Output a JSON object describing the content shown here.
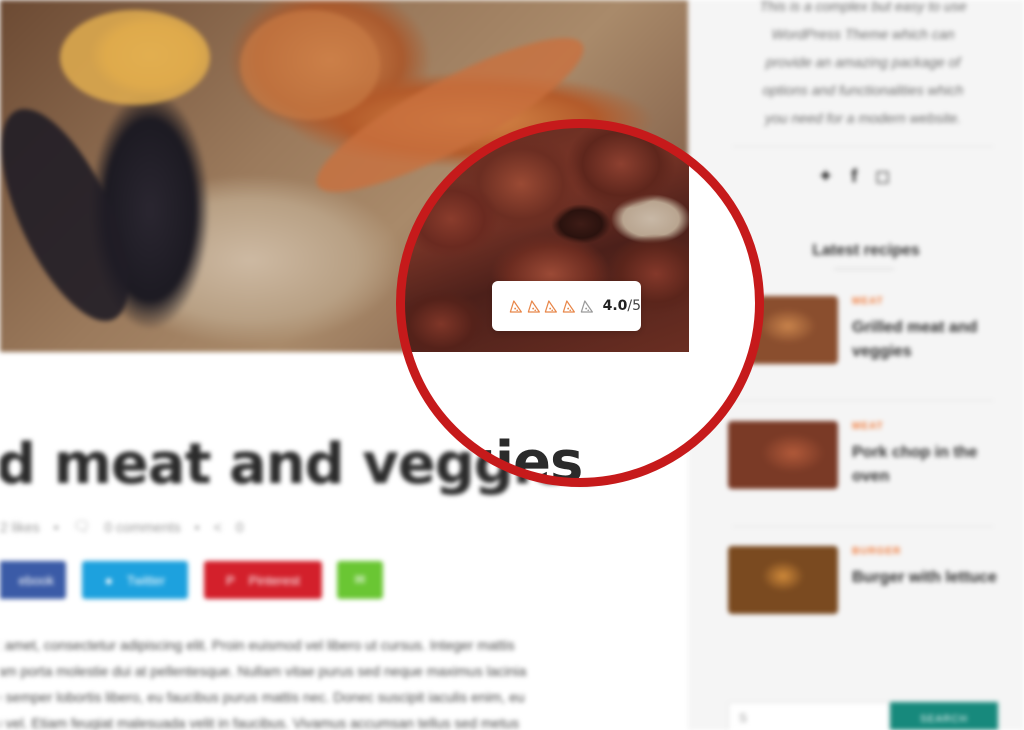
{
  "post": {
    "title": "d meat and veggies",
    "meta": {
      "likes": "2 likes",
      "comments": "0 comments",
      "shares": "0"
    },
    "share_buttons": {
      "facebook": "ebook",
      "twitter": "Twitter",
      "pinterest": "Pinterest"
    },
    "body_lines": [
      "it amet, consectetur adipiscing elit. Proin euismod vel libero ut cursus. Integer mattis",
      "iam porta molestie dui at pellentesque. Nullam vitae purus sed neque maximus lacinia",
      "e semper lobortis libero, eu faucibus purus mattis nec. Donec suscipit iaculis enim, eu",
      "u vel. Etiam feugiat malesuada velit in faucibus. Vivamus accumsan tellus sed metus"
    ]
  },
  "rating": {
    "value": "4.0",
    "max": "/5",
    "filled_slices": 4,
    "total_slices": 5,
    "filled_color": "#e8874a",
    "empty_color": "#9a9a9a"
  },
  "lens": {
    "title_fragment": "ed meat and veggies",
    "ring_color": "#c61a1b"
  },
  "sidebar": {
    "about_lines": [
      "This is a complex but easy to use",
      "WordPress Theme which can",
      "provide an amazing package of",
      "options and functionalities which",
      "you need for a modern website."
    ],
    "latest_heading": "Latest recipes",
    "recipes": [
      {
        "category": "MEAT",
        "name": "Grilled meat and veggies"
      },
      {
        "category": "MEAT",
        "name": "Pork chop in the oven"
      },
      {
        "category": "BURGER",
        "name": "Burger with lettuce"
      }
    ],
    "search": {
      "placeholder": "S",
      "button": "SEARCH"
    },
    "accent_color": "#f07a3a",
    "search_button_color": "#17897c"
  }
}
